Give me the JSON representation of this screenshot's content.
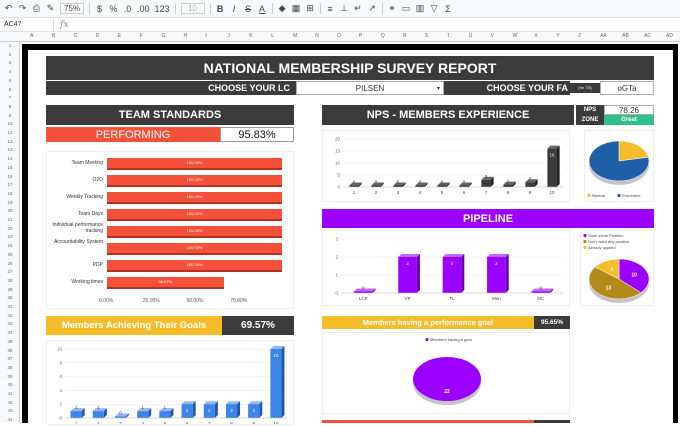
{
  "toolbar": {
    "zoom": "75%",
    "font_size": "10",
    "currency": "$",
    "percent": "%",
    "dec_dec": ".0",
    "dec_inc": ".00",
    "more_formats": "123",
    "bold": "B",
    "italic": "I",
    "strike": "S",
    "text_color": "A",
    "sum": "Σ"
  },
  "formula_bar": {
    "cell_ref": "AC47",
    "fx": "fx"
  },
  "columns": [
    "A",
    "B",
    "C",
    "D",
    "E",
    "F",
    "G",
    "H",
    "I",
    "J",
    "K",
    "L",
    "M",
    "N",
    "O",
    "P",
    "Q",
    "R",
    "S",
    "T",
    "U",
    "V",
    "W",
    "X",
    "Y",
    "Z",
    "AA",
    "AB",
    "AC",
    "AD"
  ],
  "report": {
    "title": "NATIONAL MEMBERSHIP SURVEY REPORT",
    "choose_lc_label": "CHOOSE YOUR LC",
    "choose_lc_value": "PILSEN",
    "choose_fa_label": "CHOOSE YOUR FA",
    "choose_fa_sub": "(for TS)",
    "choose_fa_value": "oGTa"
  },
  "team_standards": {
    "title": "TEAM STANDARDS",
    "status": "PERFORMING",
    "score": "95.83%",
    "accent": "#f4513a"
  },
  "nps": {
    "title": "NPS - MEMBERS EXPERIENCE",
    "label": "NPS",
    "value": "78.26",
    "zone_label": "ZONE",
    "zone_value": "Great",
    "zone_color": "#2ec08a"
  },
  "pipeline": {
    "title": "PIPELINE",
    "color": "#9b00ff"
  },
  "goals": {
    "title": "Members Achieving Their Goals",
    "score": "69.57%",
    "accent": "#f6bd2b"
  },
  "perf_goal": {
    "title": "Members having a performance goal",
    "score": "95.65%"
  },
  "chart_data": [
    {
      "type": "bar",
      "orientation": "horizontal",
      "categories": [
        "Team Meeting",
        "O2O",
        "Weekly Tracking",
        "Team Days",
        "Individual performance tracking",
        "Accountability System",
        "PDP",
        "Working times"
      ],
      "values": [
        100,
        100,
        100,
        100,
        100,
        100,
        100,
        66.67
      ],
      "value_labels": [
        "100.00%",
        "100.00%",
        "100.00%",
        "100.00%",
        "100.00%",
        "100.00%",
        "100.00%",
        "66.67%"
      ],
      "x_ticks": [
        "0.00%",
        "25.00%",
        "50.00%",
        "75.00%"
      ],
      "color": "#f4513a"
    },
    {
      "type": "bar",
      "categories": [
        "1",
        "2",
        "3",
        "4",
        "5",
        "6",
        "7",
        "8",
        "9",
        "10"
      ],
      "values": [
        0,
        0,
        0,
        0,
        0,
        0,
        3,
        1,
        2,
        16
      ],
      "y_ticks": [
        "0",
        "5",
        "10",
        "15",
        "20"
      ],
      "ylim": [
        0,
        20
      ],
      "color": "#3b3b3b"
    },
    {
      "type": "pie",
      "labels": [
        "Neutral",
        "Promoters"
      ],
      "values": [
        22,
        78
      ],
      "colors": [
        "#f6bd2b",
        "#1f5fa8"
      ]
    },
    {
      "type": "bar",
      "categories": [
        "LCP",
        "VP",
        "TL",
        "Man",
        "MC"
      ],
      "values": [
        0,
        2,
        2,
        2,
        0
      ],
      "y_ticks": [
        "0",
        "1",
        "2",
        "3"
      ],
      "ylim": [
        0,
        3
      ],
      "color": "#9b00ff"
    },
    {
      "type": "pie",
      "labels": [
        "Want some Position",
        "Don't want any position",
        "Already applied"
      ],
      "values": [
        10,
        13,
        4
      ],
      "colors": [
        "#9b00ff",
        "#b38a1a",
        "#f6bd2b"
      ]
    },
    {
      "type": "bar",
      "categories": [
        "1",
        "2",
        "3",
        "4",
        "5",
        "6",
        "7",
        "8",
        "9",
        "10"
      ],
      "values": [
        1,
        1,
        0,
        1,
        1,
        2,
        2,
        2,
        2,
        10
      ],
      "y_ticks": [
        "0",
        "2",
        "4",
        "6",
        "8",
        "10"
      ],
      "ylim": [
        0,
        10
      ],
      "color": "#3d85e8"
    },
    {
      "type": "pie",
      "labels": [
        "Members having a goal"
      ],
      "values": [
        22
      ],
      "colors": [
        "#9b00ff"
      ]
    }
  ]
}
